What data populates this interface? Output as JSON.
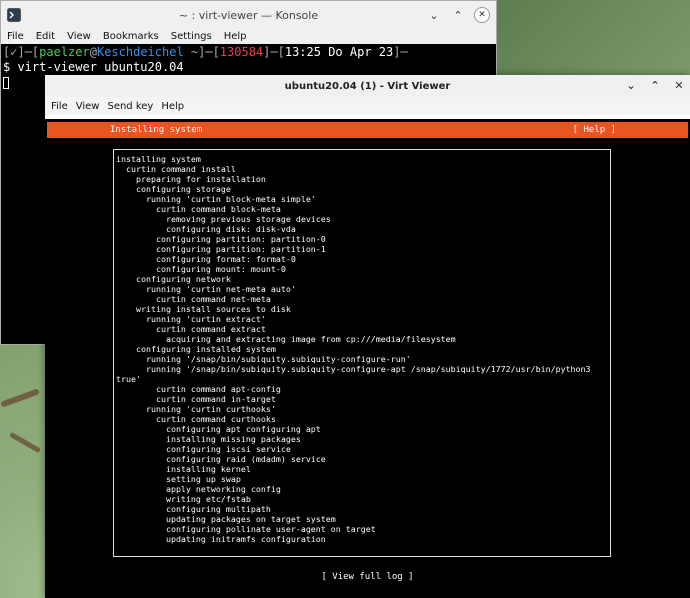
{
  "konsole": {
    "title": "~ : virt-viewer — Konsole",
    "menu": [
      "File",
      "Edit",
      "View",
      "Bookmarks",
      "Settings",
      "Help"
    ],
    "prompt": {
      "open": "[",
      "dir": "✓",
      "sep1": "]─[",
      "user": "paelzer",
      "at": "@",
      "host": "Keschdeichel",
      "sep2": " ~]─[",
      "jobs": "130584",
      "sep3": "]─[",
      "time": "13:25 Do Apr 23",
      "close": "]─"
    },
    "command": "$ virt-viewer ubuntu20.04"
  },
  "virt": {
    "title": "ubuntu20.04 (1) - Virt Viewer",
    "menu": [
      "File",
      "View",
      "Send key",
      "Help"
    ],
    "header": "Installing system",
    "help": "[ Help ]",
    "log": [
      "installing system",
      "  curtin command install",
      "    preparing for installation",
      "    configuring storage",
      "      running 'curtin block-meta simple'",
      "        curtin command block-meta",
      "          removing previous storage devices",
      "          configuring disk: disk-vda",
      "        configuring partition: partition-0",
      "        configuring partition: partition-1",
      "        configuring format: format-0",
      "        configuring mount: mount-0",
      "    configuring network",
      "      running 'curtin net-meta auto'",
      "        curtin command net-meta",
      "    writing install sources to disk",
      "      running 'curtin extract'",
      "        curtin command extract",
      "          acquiring and extracting image from cp:///media/filesystem",
      "    configuring installed system",
      "      running '/snap/bin/subiquity.subiquity-configure-run'",
      "      running '/snap/bin/subiquity.subiquity-configure-apt /snap/subiquity/1772/usr/bin/python3",
      "true'",
      "        curtin command apt-config",
      "        curtin command in-target",
      "      running 'curtin curthooks'",
      "        curtin command curthooks",
      "          configuring apt configuring apt",
      "          installing missing packages",
      "          configuring iscsi service",
      "          configuring raid (mdadm) service",
      "          installing kernel",
      "          setting up swap",
      "          apply networking config",
      "          writing etc/fstab",
      "          configuring multipath",
      "          updating packages on target system",
      "          configuring pollinate user-agent on target",
      "          updating initramfs configuration"
    ],
    "view_log": "[ View full log ]"
  },
  "colors": {
    "ubuntu_orange": "#e95420",
    "terminal_bg": "#000000",
    "titlebar_bg": "#eff0f1"
  }
}
